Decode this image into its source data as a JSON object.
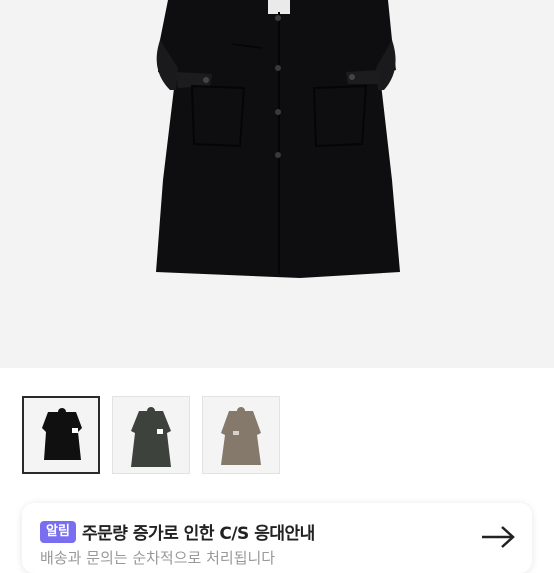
{
  "notice": {
    "badge": "알림",
    "title": "주문량 증가로 인한 C/S 응대안내",
    "subtitle": "배송과 문의는 순차적으로 처리됩니다"
  },
  "colors": {
    "badge_bg": "#7a6ef0",
    "coat_black": "#111111",
    "coat_charcoal": "#3d423c",
    "coat_taupe": "#85796b"
  },
  "thumbnails": [
    {
      "name": "black",
      "selected": true
    },
    {
      "name": "charcoal",
      "selected": false
    },
    {
      "name": "taupe",
      "selected": false
    }
  ]
}
